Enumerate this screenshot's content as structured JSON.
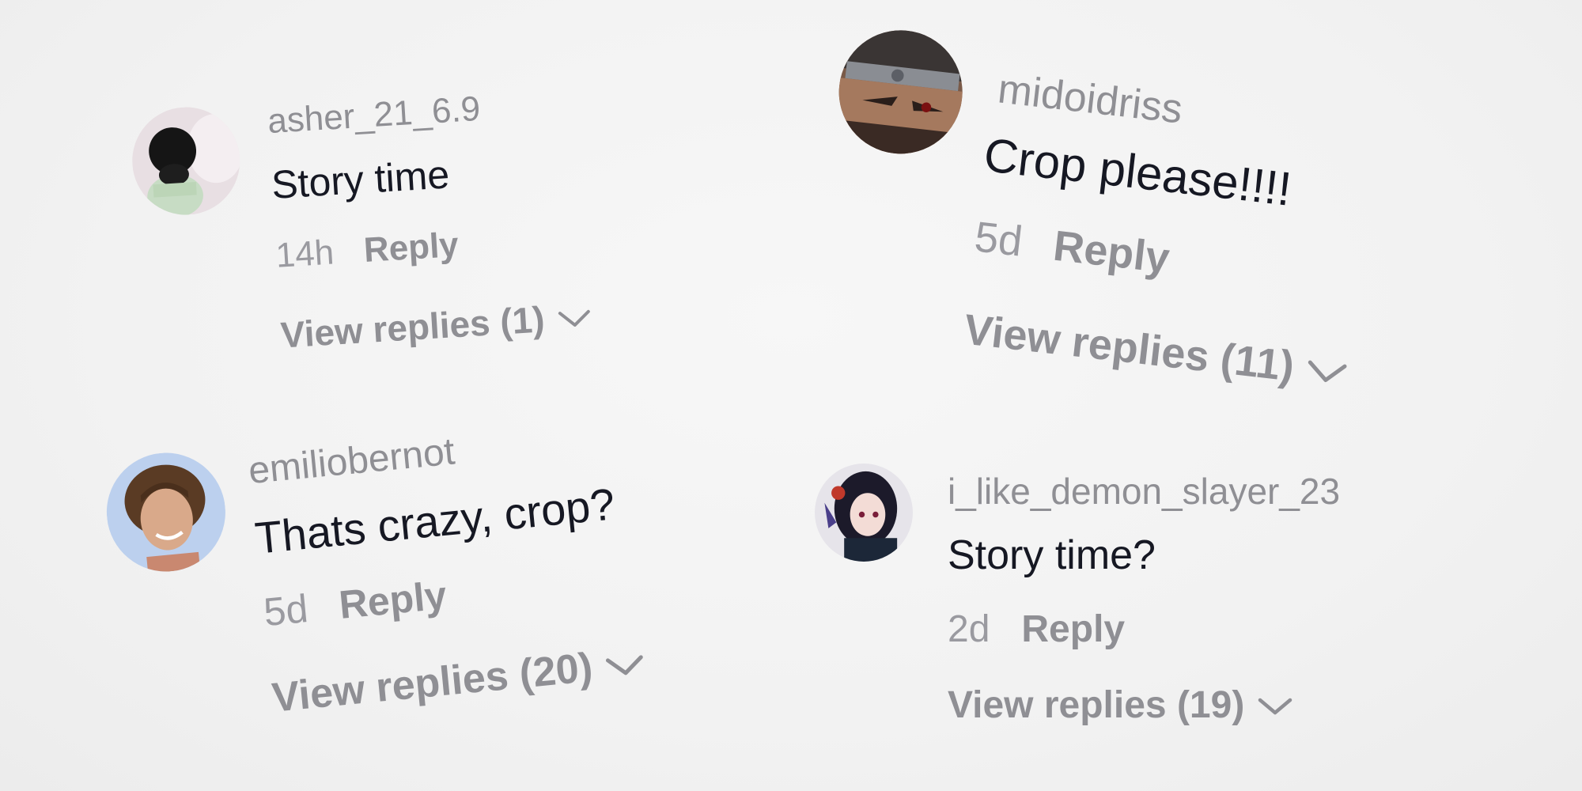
{
  "comments": [
    {
      "username": "asher_21_6.9",
      "text": "Story time",
      "time": "14h",
      "reply_label": "Reply",
      "view_replies": "View replies (1)",
      "chevron_icon": "chevron-down-icon"
    },
    {
      "username": "midoidriss",
      "text": "Crop please!!!!",
      "time": "5d",
      "reply_label": "Reply",
      "view_replies": "View replies (11)",
      "chevron_icon": "chevron-down-icon"
    },
    {
      "username": "emiliobernot",
      "text": "Thats crazy, crop?",
      "time": "5d",
      "reply_label": "Reply",
      "view_replies": "View replies (20)",
      "chevron_icon": "chevron-down-icon"
    },
    {
      "username": "i_like_demon_slayer_23",
      "text": "Story time?",
      "time": "2d",
      "reply_label": "Reply",
      "view_replies": "View replies (19)",
      "chevron_icon": "chevron-down-icon"
    }
  ],
  "colors": {
    "background": "#f3f3f3",
    "username": "#8f8f94",
    "comment_text": "#161823",
    "secondary": "#9a9aa0"
  }
}
